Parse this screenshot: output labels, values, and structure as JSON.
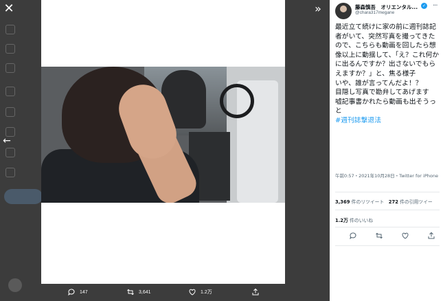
{
  "viewer": {
    "close_icon": "close-icon",
    "collapse_icon": "double-chevron-right-icon",
    "prev_icon": "arrow-left-icon"
  },
  "actions": {
    "replies": "147",
    "retweets": "3,641",
    "likes": "1.2万"
  },
  "tweet": {
    "display_name": "藤森慎吾　オリエンタル...",
    "handle": "@chara317megane",
    "text_main": "最近立て続けに家の前に週刊誌記者がいて、突然写真を撮ってきたので、こちらも動画を回したら想像以上に動揺して、「え？これ何かに出るんですか？出さないでもらえますか？」と、焦る様子\nいや、誰が言ってんだよ！？\n目隠し写真で勘弁してあげます\n嘘記事書かれたら動画も出そうっと",
    "hashtag": "#週刊誌撃退法",
    "meta": "午前0:57・2021年10月28日・Twitter for iPhone",
    "retweets_count": "3,369",
    "retweets_label": "件のリツイート",
    "quotes_count": "272",
    "quotes_label": "件の引用ツイー",
    "likes_count": "1.2万",
    "likes_label": "件のいいね"
  },
  "colors": {
    "accent": "#1d9bf0",
    "overlay": "#1a1a1a"
  }
}
